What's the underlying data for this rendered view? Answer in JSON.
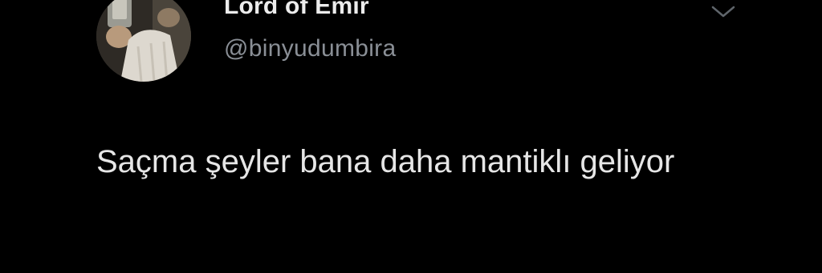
{
  "tweet": {
    "display_name": "Lord of Emir",
    "handle": "@binyudumbira",
    "text": "Saçma şeyler bana daha mantiklı geliyor"
  },
  "icons": {
    "avatar": "user-avatar",
    "menu": "chevron-down-icon"
  },
  "colors": {
    "background": "#000000",
    "name": "#ececec",
    "handle": "#8a8f96",
    "text": "#e6e6e6"
  }
}
